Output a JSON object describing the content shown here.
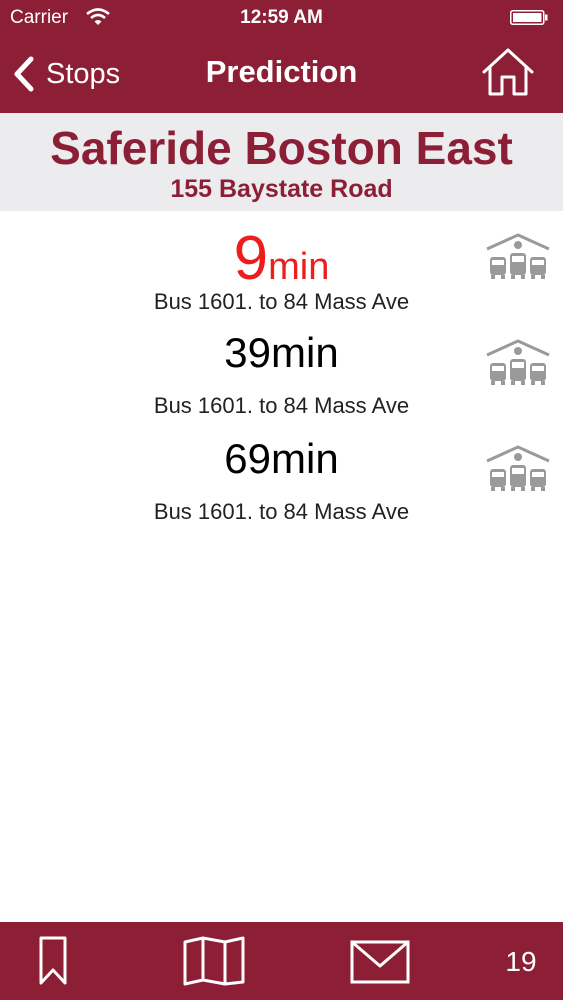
{
  "status_bar": {
    "carrier": "Carrier",
    "time": "12:59 AM"
  },
  "nav": {
    "back_label": "Stops",
    "title": "Prediction"
  },
  "stop": {
    "name": "Saferide Boston East",
    "address": "155 Baystate Road"
  },
  "predictions": [
    {
      "minutes": "9",
      "unit": "min",
      "route": "Bus 1601. to 84 Mass Ave"
    },
    {
      "minutes": "39",
      "unit": "min",
      "route": "Bus 1601. to 84 Mass Ave"
    },
    {
      "minutes": "69",
      "unit": "min",
      "route": "Bus 1601. to 84 Mass Ave"
    }
  ],
  "tab_bar": {
    "count": "19"
  },
  "colors": {
    "brand": "#8c1f36",
    "highlight": "#ee1c1c",
    "header_bg": "#ececee"
  },
  "icons": [
    "wifi-icon",
    "battery-icon",
    "back-chevron-icon",
    "home-icon",
    "bus-depot-icon",
    "bookmark-icon",
    "map-icon",
    "mail-icon"
  ]
}
